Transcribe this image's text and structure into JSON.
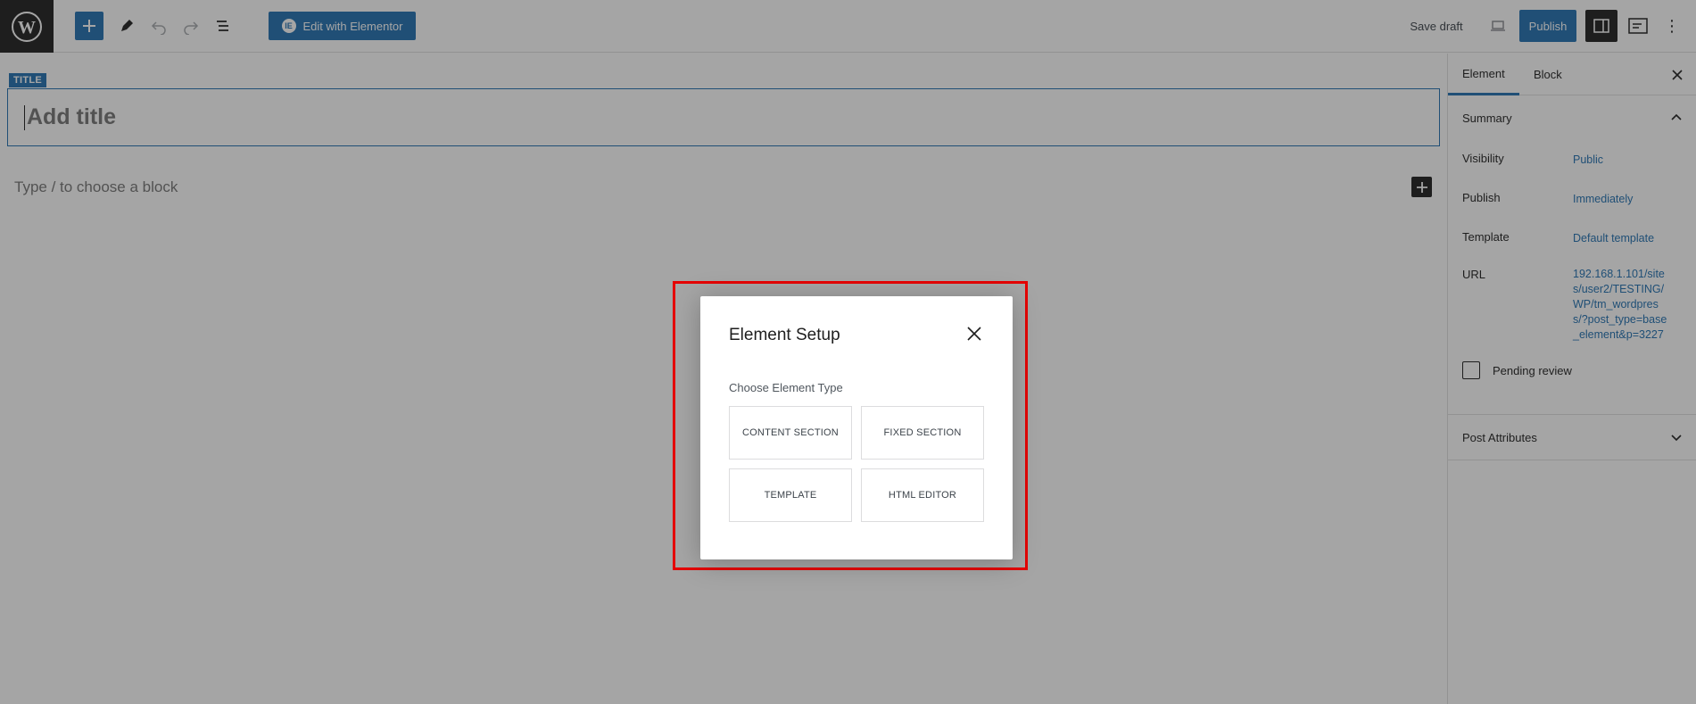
{
  "toolbar": {
    "elementor_label": "Edit with Elementor",
    "save_draft_label": "Save draft",
    "publish_label": "Publish"
  },
  "editor": {
    "title_tag": "TITLE",
    "title_placeholder": "Add title",
    "block_placeholder": "Type / to choose a block"
  },
  "sidebar": {
    "tabs": [
      {
        "label": "Element"
      },
      {
        "label": "Block"
      }
    ],
    "summary": {
      "heading": "Summary",
      "rows": [
        {
          "label": "Visibility",
          "value": "Public"
        },
        {
          "label": "Publish",
          "value": "Immediately"
        },
        {
          "label": "Template",
          "value": "Default template"
        },
        {
          "label": "URL",
          "value": "192.168.1.101/sites/user2/TESTING/WP/tm_wordpress/?post_type=base_element&p=3227"
        }
      ],
      "pending_review_label": "Pending review"
    },
    "post_attributes_heading": "Post Attributes"
  },
  "modal": {
    "title": "Element Setup",
    "label": "Choose Element Type",
    "options": [
      {
        "label": "CONTENT SECTION"
      },
      {
        "label": "FIXED SECTION"
      },
      {
        "label": "TEMPLATE"
      },
      {
        "label": "HTML EDITOR"
      }
    ]
  },
  "icons": {
    "logo": "wordpress-logo",
    "add": "plus-icon",
    "tools": "pencil-icon",
    "undo": "undo-icon",
    "redo": "redo-icon",
    "list_view": "list-view-icon",
    "preview": "laptop-icon",
    "settings": "sidebar-icon",
    "close": "close-icon",
    "more": "more-vertical-icon"
  },
  "colors": {
    "accent": "#2271b1",
    "dark": "#1e1e1e",
    "highlight": "#e50000"
  }
}
